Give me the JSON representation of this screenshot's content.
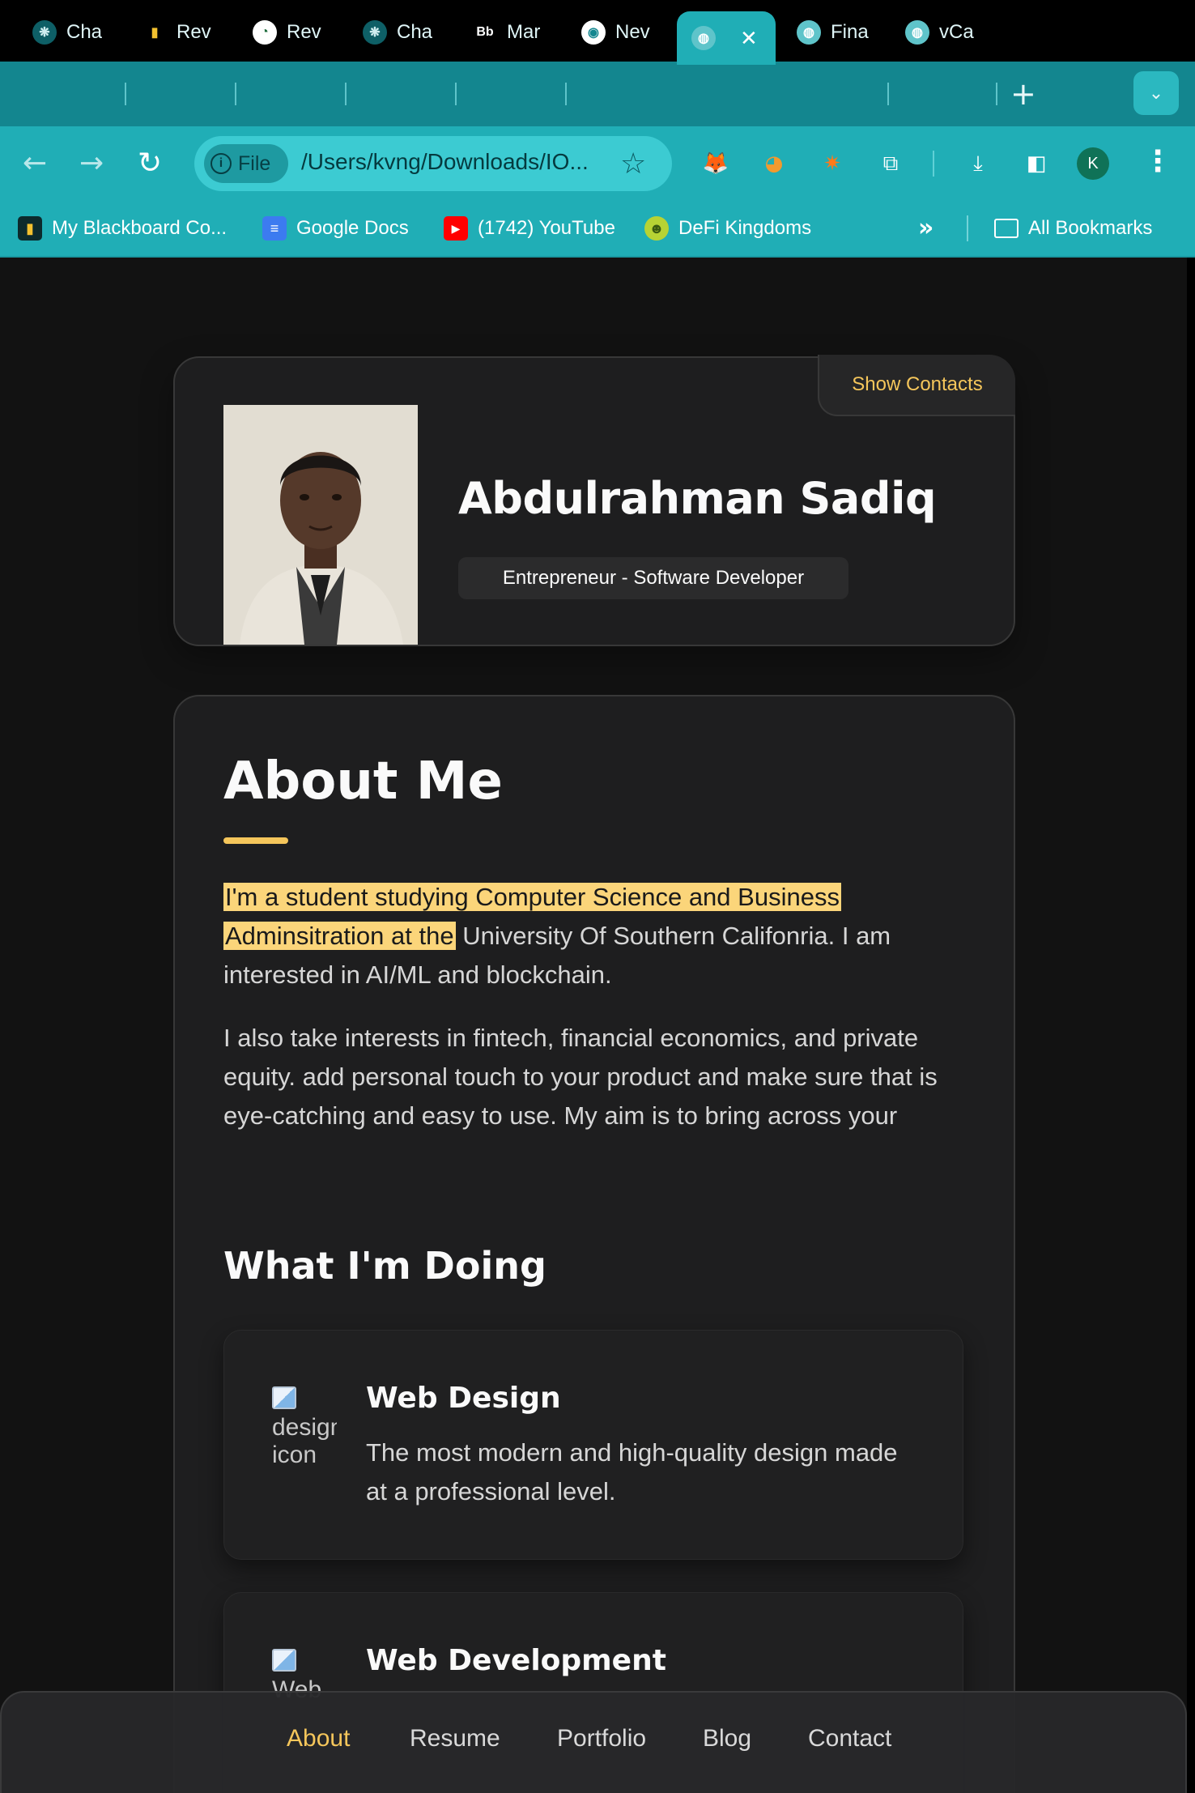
{
  "browser": {
    "tabs": [
      {
        "label": "Cha",
        "icon": "chatgpt-icon"
      },
      {
        "label": "Rev",
        "icon": "bar-chart-icon"
      },
      {
        "label": "Rev",
        "icon": "chart-circle-icon"
      },
      {
        "label": "Cha",
        "icon": "chatgpt-icon"
      },
      {
        "label": "Mar",
        "icon": "blackboard-icon",
        "icon_text": "Bb"
      },
      {
        "label": "Nev",
        "icon": "chrome-icon"
      },
      {
        "label": "",
        "icon": "globe-icon",
        "active": true,
        "close": "✕"
      },
      {
        "label": "Fina",
        "icon": "globe-icon"
      },
      {
        "label": "vCa",
        "icon": "globe-icon"
      }
    ],
    "new_tab": "+",
    "address": {
      "chip_label": "File",
      "url": "/Users/kvng/Downloads/IO..."
    },
    "profile_initial": "K",
    "bookmarks": [
      {
        "label": "My Blackboard Co...",
        "icon": "bar-chart-icon"
      },
      {
        "label": "Google Docs",
        "icon": "docs-icon"
      },
      {
        "label": "(1742) YouTube",
        "icon": "youtube-icon"
      },
      {
        "label": "DeFi Kingdoms",
        "icon": "defi-icon"
      }
    ],
    "all_bookmarks": "All Bookmarks",
    "colors": {
      "tabstrip": "#13868f",
      "toolbar": "#20aeb6"
    }
  },
  "profile": {
    "show_contacts": "Show Contacts",
    "name": "Abdulrahman Sadiq",
    "title": "Entrepreneur - Software Developer"
  },
  "about": {
    "heading": "About Me",
    "para1_highlight_line1": "I'm a student studying Computer Science and Business",
    "para1_highlight_line2": "Adminsitration at the",
    "para1_rest_line2": " University Of Southern Califonria. I am",
    "para1_line3": "interested in AI/ML and blockchain.",
    "para2": "I also take interests in fintech, financial economics, and private equity. add personal touch to your product and make sure that is eye-catching and easy to use. My aim is to bring across your"
  },
  "doing": {
    "heading": "What I'm Doing",
    "services": [
      {
        "title": "Web Design",
        "text": "The most modern and high-quality design made at a professional level.",
        "icon_alt": "design icon"
      },
      {
        "title": "Web Development",
        "text": "",
        "icon_alt": "Web"
      }
    ]
  },
  "nav": {
    "items": [
      "About",
      "Resume",
      "Portfolio",
      "Blog",
      "Contact"
    ],
    "active": "About"
  },
  "accent_color": "#f5c65b"
}
